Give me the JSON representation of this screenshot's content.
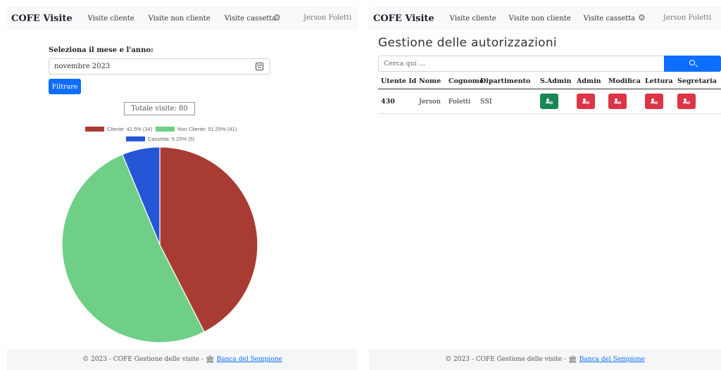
{
  "left_navbar": {
    "brand": "COFE Visite",
    "links": [
      "Visite cliente",
      "Visite non cliente",
      "Visite cassetta"
    ],
    "user": "Jerson Foletti"
  },
  "right_navbar": {
    "brand": "COFE Visite",
    "links": [
      "Visite cliente",
      "Visite non cliente",
      "Visite cassetta"
    ],
    "user": "Jerson Foletti"
  },
  "filter": {
    "label": "Seleziona il mese e l'anno:",
    "month_value": "novembre 2023",
    "button_label": "Filtrare"
  },
  "total_visits": "Totale visite: 80",
  "chart_data": {
    "type": "pie",
    "slices": [
      {
        "name": "Cliente",
        "value": 34,
        "label": "Cliente: 42.5% (34)",
        "color": "#a83c32"
      },
      {
        "name": "Non Cliente",
        "value": 41,
        "label": "Non Cliente: 51.25% (41)",
        "color": "#6fcf87"
      },
      {
        "name": "Cassetta",
        "value": 5,
        "label": "Cassetta: 6.25% (5)",
        "color": "#2456d6"
      }
    ],
    "legend_position": "top"
  },
  "permissions": {
    "title": "Gestione delle autorizzazioni",
    "search_placeholder": "Cerca qui ...",
    "columns": [
      "Utente Id",
      "Nome",
      "Cognome",
      "Dipartimento",
      "S.Admin",
      "Admin",
      "Modifica",
      "Lettura",
      "Segretaria"
    ],
    "rows": [
      {
        "id": "430",
        "nome": "Jerson",
        "cognome": "Foletti",
        "dipartimento": "SSI",
        "s_admin": true,
        "admin": false,
        "modifica": false,
        "lettura": false,
        "segretaria": false
      }
    ],
    "colors": {
      "granted": "#198754",
      "denied": "#dc3545",
      "primary": "#0d6efd"
    }
  },
  "footer": {
    "text": "© 2023 - COFE Gestione delle visite -",
    "link": "Banca del Sempione",
    "icon": "bank-icon"
  }
}
